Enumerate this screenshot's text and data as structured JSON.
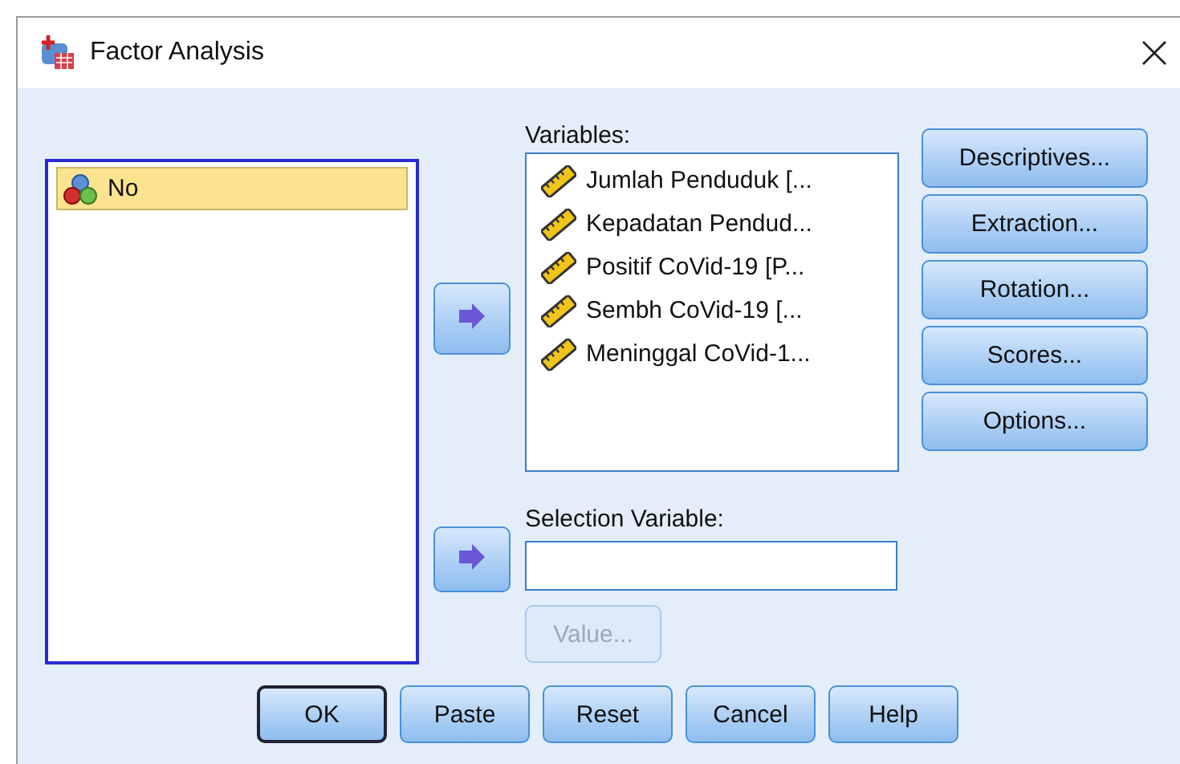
{
  "window": {
    "title": "Factor Analysis"
  },
  "source_list": {
    "items": [
      {
        "label": "No",
        "kind": "nominal",
        "selected": true
      }
    ]
  },
  "variables": {
    "label": "Variables:",
    "items": [
      {
        "label": "Jumlah Penduduk [...",
        "kind": "scale",
        "selected": false
      },
      {
        "label": "Kepadatan Pendud...",
        "kind": "scale",
        "selected": false
      },
      {
        "label": "Positif CoVid-19 [P...",
        "kind": "scale",
        "selected": false
      },
      {
        "label": "Sembh CoVid-19 [...",
        "kind": "scale",
        "selected": false
      },
      {
        "label": "Meninggal CoVid-1...",
        "kind": "scale",
        "selected": false
      }
    ]
  },
  "selection_variable": {
    "label": "Selection Variable:",
    "value_button": {
      "label": "Value...",
      "disabled": true
    }
  },
  "side_buttons": [
    {
      "label": "Descriptives..."
    },
    {
      "label": "Extraction..."
    },
    {
      "label": "Rotation..."
    },
    {
      "label": "Scores..."
    },
    {
      "label": "Options..."
    }
  ],
  "bottom_buttons": [
    {
      "label": "OK",
      "default": true
    },
    {
      "label": "Paste",
      "default": false
    },
    {
      "label": "Reset",
      "default": false
    },
    {
      "label": "Cancel",
      "default": false
    },
    {
      "label": "Help",
      "default": false
    }
  ]
}
